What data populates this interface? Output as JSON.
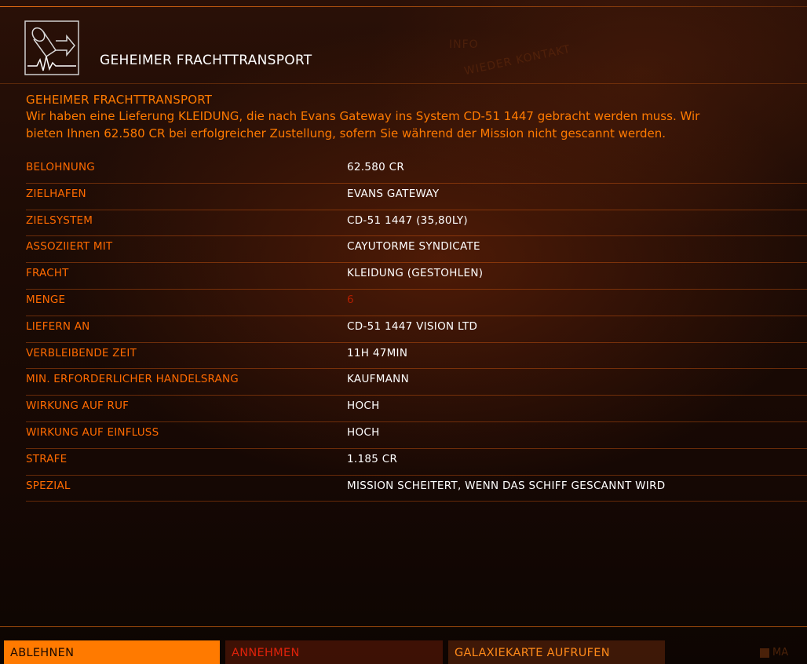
{
  "header": {
    "title": "GEHEIMER FRACHTTRANSPORT",
    "icon": "cargo-scanner-icon",
    "ghost_info": "INFO",
    "ghost_contact": "WIEDER KONTAKT"
  },
  "mission": {
    "heading": "GEHEIMER FRACHTTRANSPORT",
    "description_line1": "Wir haben eine Lieferung KLEIDUNG, die nach Evans Gateway ins System CD-51 1447 gebracht werden muss. Wir",
    "description_line2": "bieten Ihnen 62.580 CR bei erfolgreicher Zustellung, sofern Sie während der Mission nicht gescannt werden."
  },
  "details": [
    {
      "label": "BELOHNUNG",
      "value": "62.580 CR"
    },
    {
      "label": "ZIELHAFEN",
      "value": "EVANS GATEWAY"
    },
    {
      "label": "ZIELSYSTEM",
      "value": "CD-51 1447 (35,80LY)"
    },
    {
      "label": "ASSOZIIERT MIT",
      "value": "CAYUTORME SYNDICATE"
    },
    {
      "label": "FRACHT",
      "value": "KLEIDUNG (GESTOHLEN)"
    },
    {
      "label": "MENGE",
      "value": "6"
    },
    {
      "label": "LIEFERN AN",
      "value": "CD-51 1447 VISION LTD"
    },
    {
      "label": "VERBLEIBENDE ZEIT",
      "value": "11H 47MIN"
    },
    {
      "label": "MIN. ERFORDERLICHER HANDELSRANG",
      "value": "KAUFMANN"
    },
    {
      "label": "WIRKUNG AUF RUF",
      "value": "HOCH"
    },
    {
      "label": "WIRKUNG AUF EINFLUSS",
      "value": "HOCH"
    },
    {
      "label": "STRAFE",
      "value": "1.185 CR"
    },
    {
      "label": "SPEZIAL",
      "value": "MISSION SCHEITERT, WENN DAS SCHIFF GESCANNT WIRD"
    }
  ],
  "buttons": {
    "decline": "ABLEHNEN",
    "accept": "ANNEHMEN",
    "galaxy_map": "GALAXIEKARTE AUFRUFEN"
  },
  "ghost_right": "MA",
  "colors": {
    "accent": "#ff7a00",
    "accept_text": "#e0220a",
    "quantity_red": "#b31e00"
  }
}
